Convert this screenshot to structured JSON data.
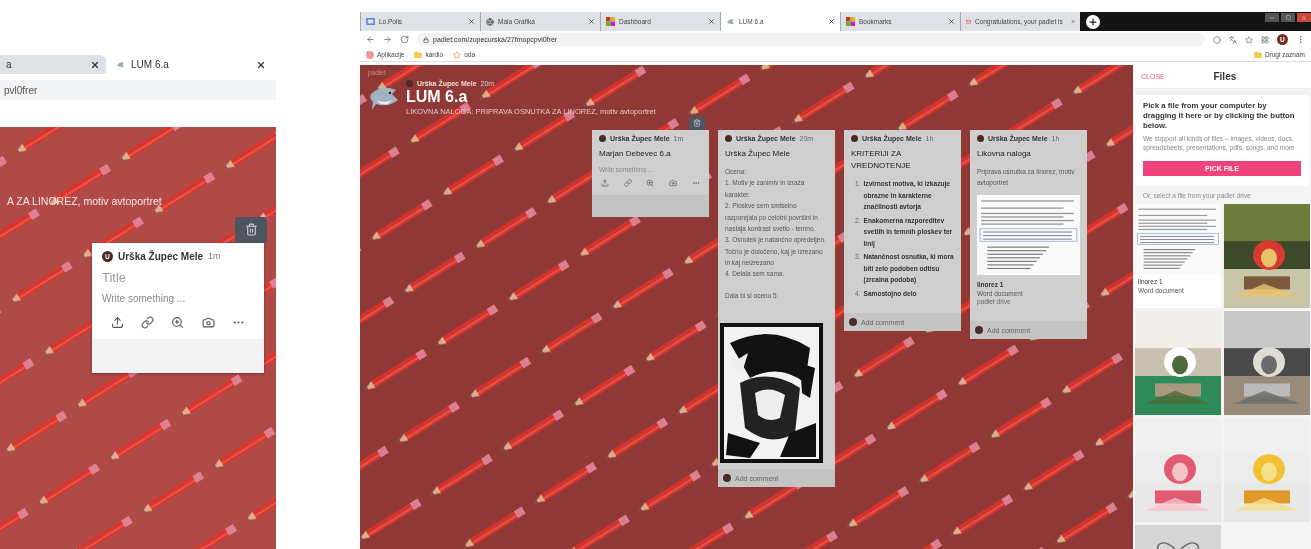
{
  "left_window": {
    "tabs": [
      {
        "label": "a",
        "selected": false
      },
      {
        "label": "LUM 6.a",
        "selected": true
      }
    ],
    "address": "pvl0frer",
    "board_subtitle": "A ZA LINOREZ, motiv avtoportret",
    "post": {
      "avatar": "U",
      "author": "Urška Župec Mele",
      "time": "1m",
      "title_placeholder": "Title",
      "body_placeholder": "Write something ..."
    }
  },
  "browser": {
    "tabs": [
      {
        "label": "Lo.Polis",
        "selected": false
      },
      {
        "label": "Mala Grafika",
        "selected": false
      },
      {
        "label": "Dashboard",
        "selected": false
      },
      {
        "label": "LUM 6.a",
        "selected": true
      },
      {
        "label": "Bookmarks",
        "selected": false
      },
      {
        "label": "Congratulations, your padlet is",
        "selected": false
      }
    ],
    "address": "padlet.com/zupecurska/27fmopcpvl0frer",
    "bookmarks": [
      {
        "label": "Aplikacije",
        "kind": "apps"
      },
      {
        "label": "kardio",
        "kind": "folder"
      },
      {
        "label": "oda",
        "kind": "site"
      }
    ],
    "other_bookmarks": "Drugi zaznam",
    "profile": "U"
  },
  "board": {
    "brand": "padlet",
    "author": "Urška Župec Mele",
    "time": "20m",
    "title": "LUM 6.a",
    "subtitle": "LIKOVNA NALOGA: PRIPRAVA OSNUTKA ZA LINOREZ, motiv avtoportret",
    "posts": [
      {
        "kind": "draft",
        "author": "Urška Župec Mele",
        "time": "1m",
        "title": "Marjan Debevec 6.a",
        "body_placeholder": "Write something ..."
      },
      {
        "kind": "text",
        "author": "Urška Župec Mele",
        "time": "20m",
        "title": "Urška Župec Mele",
        "lines": [
          "Ocena:",
          "1. Motiv je zanimiv in izraža karakter.",
          "2. Ploskve sem smiselno razporejala po celotni površini in nastaja kontrast svetlo - temno.",
          "3. Osnutek je natančno opredeljen. Točno je določeno, kaj je izrezano in kaj neizrezano",
          "4. Delala sem sama.",
          "Dala bi si oceno 5."
        ],
        "comment_placeholder": "Add comment"
      },
      {
        "kind": "list",
        "author": "Urška Župec Mele",
        "time": "1h",
        "title": "KRITERIJI ZA VREDNOTENJE",
        "items": [
          {
            "number": "1.",
            "text": "Izvirnost motiva, ki izkazuje obrazne in karakterne značilnosti avtorja"
          },
          {
            "number": "2.",
            "text": "Enakomerna razporeditev svetlih in temnih ploskev ter linij"
          },
          {
            "number": "3.",
            "text": "Natančnost osnutka, ki mora biti zelo podoben odtisu (zrcalna podoba)"
          },
          {
            "number": "4.",
            "text": "Samostojno delo"
          }
        ],
        "comment_placeholder": "Add comment"
      },
      {
        "kind": "attachment",
        "author": "Urška Župec Mele",
        "time": "1h",
        "title": "Likovna naloga",
        "body": "Priprava osnutka za linorez, motiv avtoportret",
        "file_name": "linorez 1",
        "file_type": "Word document",
        "file_source": "padlet drive",
        "comment_placeholder": "Add comment"
      }
    ]
  },
  "files_panel": {
    "close": "CLOSE",
    "title": "Files",
    "heading": "Pick a file from your computer by dragging it here or by clicking the button below.",
    "note": "We support all kinds of files – images, videos, docs, spreadsheets, presentations, pdfs, songs, and more",
    "button": "PICK FILE",
    "drive_label": "Or, select a file from your padlet drive",
    "items": [
      {
        "kind": "document",
        "name": "linorez 1",
        "type": "Word document"
      },
      {
        "kind": "picture"
      },
      {
        "kind": "picture"
      },
      {
        "kind": "picture"
      },
      {
        "kind": "picture"
      },
      {
        "kind": "picture"
      },
      {
        "kind": "picture"
      }
    ]
  }
}
